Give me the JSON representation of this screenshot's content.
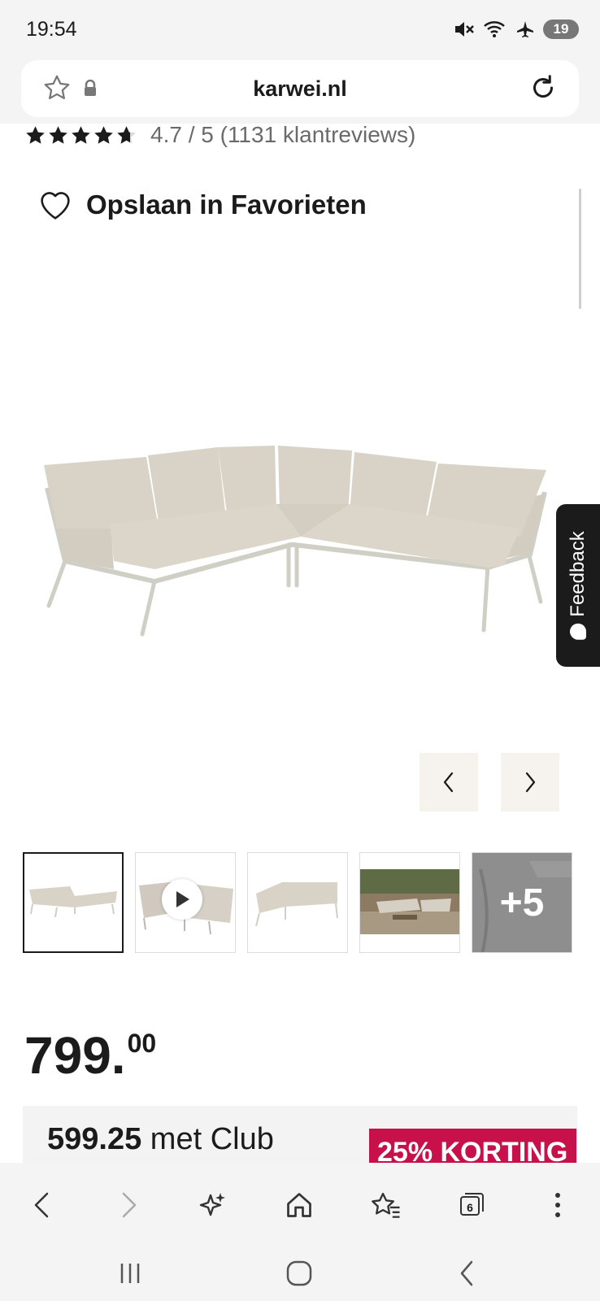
{
  "status_bar": {
    "time": "19:54",
    "battery": "19"
  },
  "browser": {
    "url": "karwei.nl",
    "tab_count": "6"
  },
  "rating": {
    "stars": 4.7,
    "text": "4.7 / 5 (1131 klantreviews)"
  },
  "favorite": {
    "label": "Opslaan in Favorieten"
  },
  "feedback": {
    "label": "Feedback"
  },
  "gallery": {
    "more_label": "+5",
    "thumbnail_count": 5
  },
  "price": {
    "main": "799.",
    "decimals": "00"
  },
  "club": {
    "price": "599.25",
    "suffix": " met Club",
    "badge": "25% KORTING"
  },
  "colors": {
    "badge": "#c8104b",
    "text": "#1b1b1b",
    "nav_button_bg": "#f6f3ef"
  }
}
